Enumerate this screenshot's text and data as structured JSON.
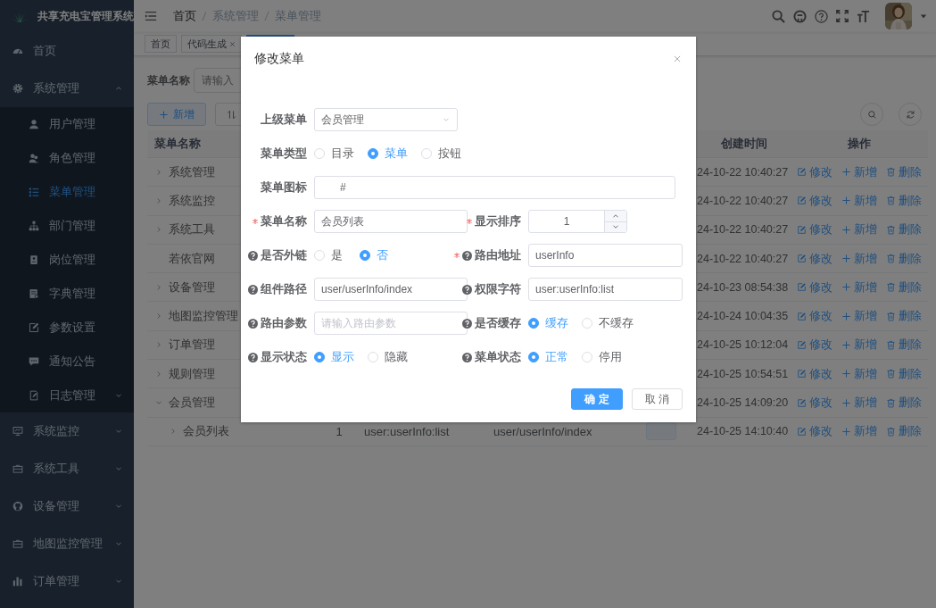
{
  "sidebar": {
    "title": "共享充电宝管理系统",
    "items": [
      {
        "label": "首页",
        "kind": "page",
        "selected": false
      },
      {
        "label": "系统管理",
        "kind": "group",
        "expanded": true,
        "selected": false,
        "children": [
          {
            "label": "用户管理",
            "kind": "page",
            "selected": false
          },
          {
            "label": "角色管理",
            "kind": "page",
            "selected": false
          },
          {
            "label": "菜单管理",
            "kind": "page",
            "selected": true
          },
          {
            "label": "部门管理",
            "kind": "page",
            "selected": false
          },
          {
            "label": "岗位管理",
            "kind": "page",
            "selected": false
          },
          {
            "label": "字典管理",
            "kind": "page",
            "selected": false
          },
          {
            "label": "参数设置",
            "kind": "page",
            "selected": false
          },
          {
            "label": "通知公告",
            "kind": "page",
            "selected": false
          },
          {
            "label": "日志管理",
            "kind": "group",
            "expanded": false,
            "selected": false
          }
        ]
      },
      {
        "label": "系统监控",
        "kind": "group",
        "expanded": false,
        "selected": false
      },
      {
        "label": "系统工具",
        "kind": "group",
        "expanded": false,
        "selected": false
      },
      {
        "label": "设备管理",
        "kind": "group",
        "expanded": false,
        "selected": false
      },
      {
        "label": "地图监控管理",
        "kind": "group",
        "expanded": false,
        "selected": false
      },
      {
        "label": "订单管理",
        "kind": "group",
        "expanded": false,
        "selected": false
      }
    ]
  },
  "breadcrumb": [
    {
      "label": "首页",
      "link": true
    },
    {
      "label": "系统管理",
      "link": false
    },
    {
      "label": "菜单管理",
      "link": false
    }
  ],
  "tags": [
    {
      "label": "首页",
      "closable": false,
      "selected": false
    },
    {
      "label": "代码生成",
      "closable": true,
      "selected": false
    },
    {
      "selected": true
    }
  ],
  "search": {
    "label": "菜单名称",
    "placeholder": "请输入"
  },
  "toolbar": [
    {
      "kind": "add",
      "label": "新增"
    },
    {
      "kind": "sort"
    }
  ],
  "table": {
    "columns": [
      "菜单名称",
      "创建时间",
      "操作"
    ],
    "rows": [
      {
        "name": "系统管理",
        "expandable": true,
        "expanded": false,
        "created": "24-10-22 10:40:27",
        "actions": [
          "修改",
          "新增",
          "删除"
        ]
      },
      {
        "name": "系统监控",
        "expandable": true,
        "expanded": false,
        "created": "24-10-22 10:40:27",
        "actions": [
          "修改",
          "新增",
          "删除"
        ]
      },
      {
        "name": "系统工具",
        "expandable": true,
        "expanded": false,
        "created": "24-10-22 10:40:27",
        "actions": [
          "修改",
          "新增",
          "删除"
        ]
      },
      {
        "name": "若依官网",
        "expandable": false,
        "created": "24-10-22 10:40:27",
        "actions": [
          "修改",
          "新增",
          "删除"
        ]
      },
      {
        "name": "设备管理",
        "expandable": true,
        "expanded": false,
        "created": "24-10-23 08:54:38",
        "actions": [
          "修改",
          "新增",
          "删除"
        ]
      },
      {
        "name": "地图监控管理",
        "expandable": true,
        "expanded": false,
        "created": "24-10-24 10:04:35",
        "actions": [
          "修改",
          "新增",
          "删除"
        ]
      },
      {
        "name": "订单管理",
        "expandable": true,
        "expanded": false,
        "created": "24-10-25 10:12:04",
        "actions": [
          "修改",
          "新增",
          "删除"
        ]
      },
      {
        "name": "规则管理",
        "expandable": true,
        "expanded": false,
        "created": "24-10-25 10:54:51",
        "actions": [
          "修改",
          "新增",
          "删除"
        ]
      },
      {
        "name": "会员管理",
        "expandable": true,
        "expanded": true,
        "created": "24-10-25 14:09:20",
        "actions": [
          "修改",
          "新增",
          "删除"
        ],
        "children": [
          {
            "name": "会员列表",
            "expandable": true,
            "expanded": false,
            "order": "1",
            "perms": "user:userInfo:list",
            "component": "user/userInfo/index",
            "created": "24-10-25 14:10:40",
            "actions": [
              "修改",
              "新增",
              "删除"
            ]
          }
        ]
      }
    ]
  },
  "dialog": {
    "title": "修改菜单",
    "rows": [
      [
        {
          "kind": "select",
          "label": "上级菜单",
          "required": false,
          "help": false,
          "value": "会员管理"
        }
      ],
      [
        {
          "kind": "radio",
          "label": "菜单类型",
          "required": false,
          "help": false,
          "options": [
            {
              "label": "目录",
              "selected": false
            },
            {
              "label": "菜单",
              "selected": true
            },
            {
              "label": "按钮",
              "selected": false
            }
          ]
        }
      ],
      [
        {
          "kind": "input",
          "label": "菜单图标",
          "required": false,
          "help": false,
          "value": "#"
        }
      ],
      [
        {
          "kind": "input",
          "label": "菜单名称",
          "required": true,
          "help": false,
          "value": "会员列表"
        },
        {
          "kind": "number",
          "label": "显示排序",
          "required": true,
          "help": false,
          "value": "1"
        }
      ],
      [
        {
          "kind": "radio",
          "label": "是否外链",
          "required": false,
          "help": true,
          "options": [
            {
              "label": "是",
              "selected": false
            },
            {
              "label": "否",
              "selected": true
            }
          ]
        },
        {
          "kind": "input",
          "label": "路由地址",
          "required": true,
          "help": true,
          "value": "userInfo"
        }
      ],
      [
        {
          "kind": "input",
          "label": "组件路径",
          "required": false,
          "help": true,
          "value": "user/userInfo/index"
        },
        {
          "kind": "input",
          "label": "权限字符",
          "required": false,
          "help": true,
          "value": "user:userInfo:list"
        }
      ],
      [
        {
          "kind": "input",
          "label": "路由参数",
          "required": false,
          "help": true,
          "placeholder": "请输入路由参数"
        },
        {
          "kind": "radio",
          "label": "是否缓存",
          "required": false,
          "help": true,
          "options": [
            {
              "label": "缓存",
              "selected": true
            },
            {
              "label": "不缓存",
              "selected": false
            }
          ]
        }
      ],
      [
        {
          "kind": "radio",
          "label": "显示状态",
          "required": false,
          "help": true,
          "options": [
            {
              "label": "显示",
              "selected": true
            },
            {
              "label": "隐藏",
              "selected": false
            }
          ]
        },
        {
          "kind": "radio",
          "label": "菜单状态",
          "required": false,
          "help": true,
          "options": [
            {
              "label": "正常",
              "selected": true
            },
            {
              "label": "停用",
              "selected": false
            }
          ]
        }
      ]
    ],
    "buttons": [
      {
        "label": "确 定",
        "kind": "primary"
      },
      {
        "label": "取 消",
        "kind": "default"
      }
    ]
  }
}
